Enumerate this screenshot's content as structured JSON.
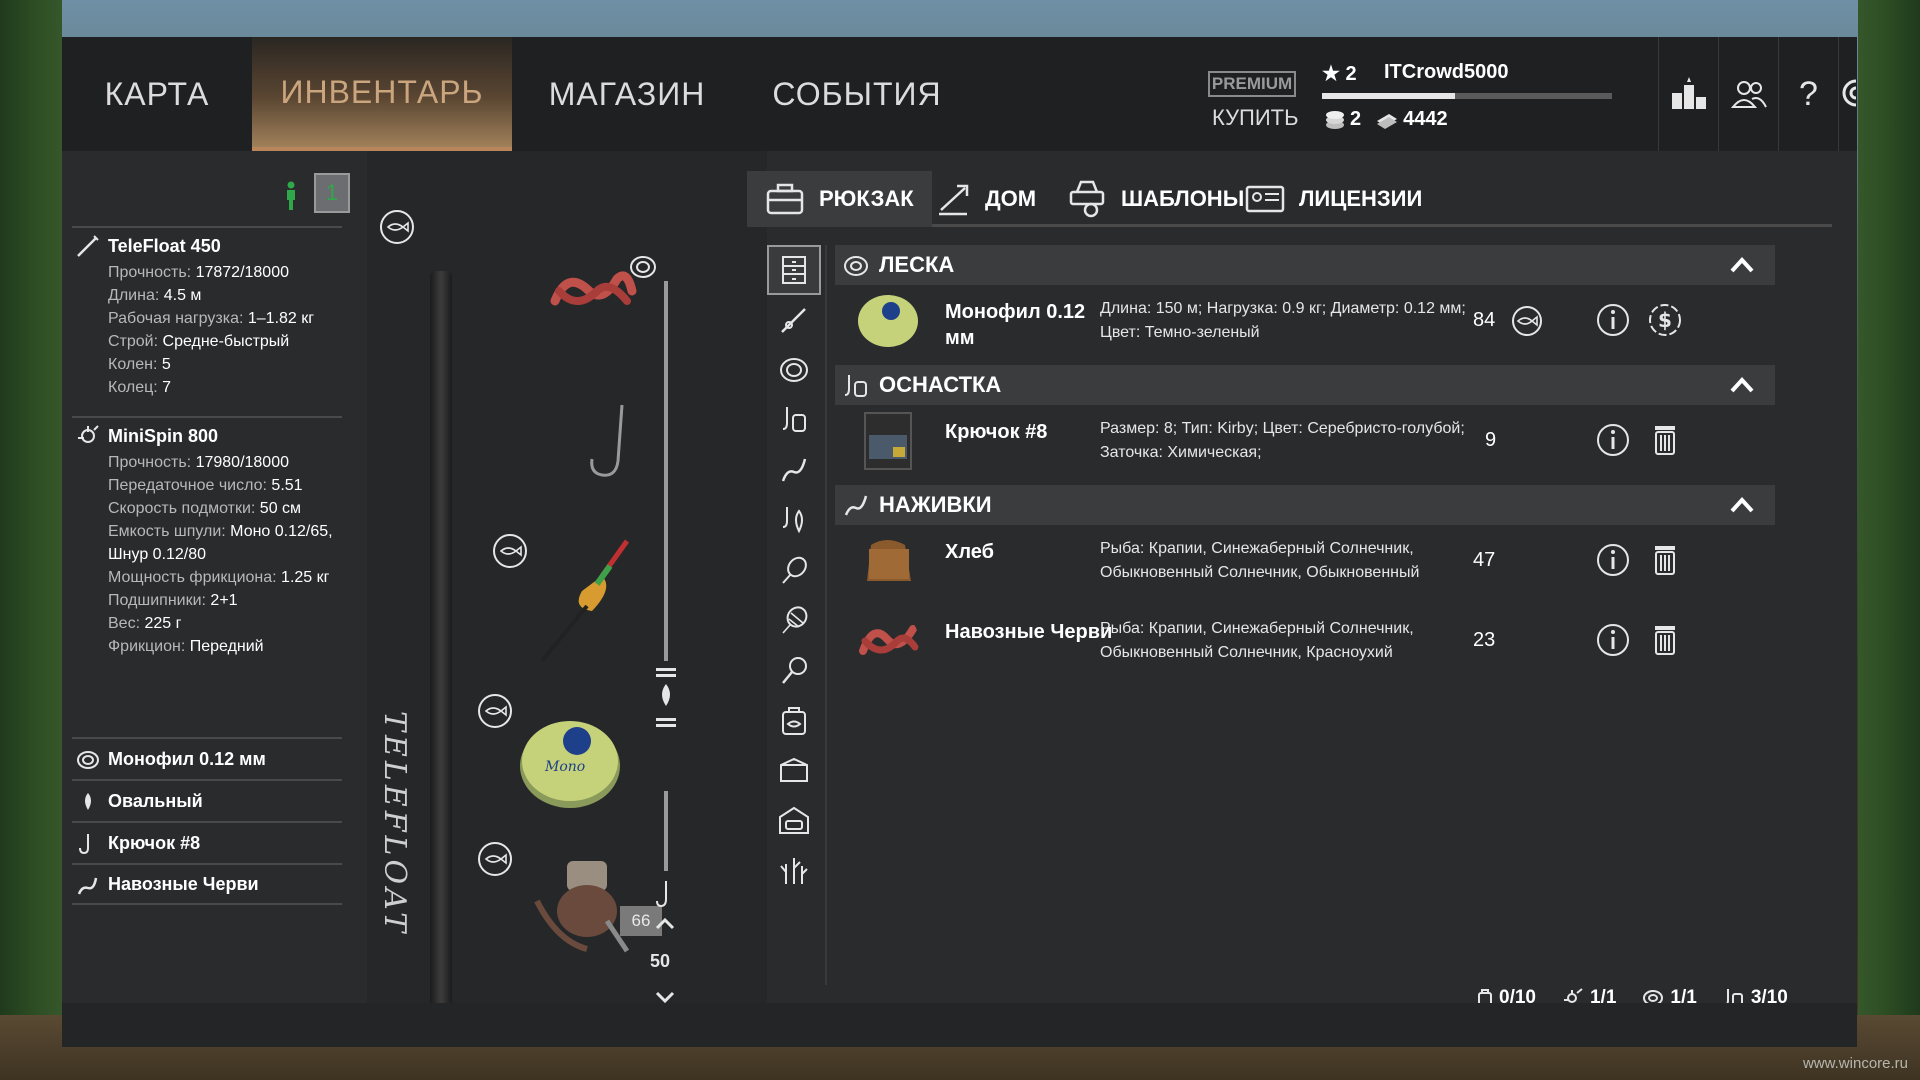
{
  "nav": {
    "tabs": [
      "КАРТА",
      "ИНВЕНТАРЬ",
      "МАГАЗИН",
      "СОБЫТИЯ"
    ],
    "active_index": 1,
    "premium_label": "PREMIUM",
    "buy_label": "КУПИТЬ"
  },
  "user": {
    "level": "2",
    "name": "ITCrowd5000",
    "xp_fraction": 0.46,
    "silver": "2",
    "gold": "4442"
  },
  "top_icons": [
    "leaderboard-icon",
    "friends-icon",
    "help-icon",
    "settings-icon"
  ],
  "help_glyph": "?",
  "rod_slot": "1",
  "rod_stats": {
    "title": "TeleFloat 450",
    "lines": [
      {
        "k": "Прочность:",
        "v": " 17872/18000"
      },
      {
        "k": "Длина:",
        "v": " 4.5 м"
      },
      {
        "k": "Рабочая нагрузка:",
        "v": " 1–1.82 кг"
      },
      {
        "k": "Строй:",
        "v": " Средне-быстрый"
      },
      {
        "k": "Колен:",
        "v": " 5"
      },
      {
        "k": "Колец:",
        "v": " 7"
      }
    ]
  },
  "reel_stats": {
    "title": "MiniSpin 800",
    "lines": [
      {
        "k": "Прочность:",
        "v": " 17980/18000"
      },
      {
        "k": "Передаточное число:",
        "v": " 5.51"
      },
      {
        "k": "Скорость подмотки:",
        "v": " 50 см"
      },
      {
        "k": "Емкость шпули:",
        "v": " Моно 0.12/65, Шнур 0.12/80"
      },
      {
        "k": "Мощность фрикциона:",
        "v": " 1.25 кг"
      },
      {
        "k": "Подшипники:",
        "v": " 2+1"
      },
      {
        "k": "Вес:",
        "v": " 225 г"
      },
      {
        "k": "Фрикцион:",
        "v": " Передний"
      }
    ]
  },
  "tackle_items": [
    "Монофил 0.12 мм",
    "Овальный",
    "Крючок #8",
    "Навозные Черви"
  ],
  "equip": {
    "rod_label": "TELEFLOAT",
    "line_counter": "66",
    "leader_value": "50"
  },
  "subtabs": [
    "РЮКЗАК",
    "ДОМ",
    "ШАБЛОНЫ",
    "ЛИЦЕНЗИИ"
  ],
  "sections": [
    {
      "title": "ЛЕСКА",
      "rows": [
        {
          "name": "Монофил 0.12 мм",
          "desc": "Длина: 150 м; Нагрузка: 0.9 кг; Диаметр: 0.12 мм; Цвет: Темно-зеленый",
          "qty": "84",
          "action2": "sell-icon"
        }
      ]
    },
    {
      "title": "ОСНАСТКА",
      "rows": [
        {
          "name": "Крючок #8",
          "desc": "Размер: 8; Тип: Kirby; Цвет: Серебристо-голубой; Заточка: Химическая;",
          "qty": "9",
          "action2": "trash-icon"
        }
      ]
    },
    {
      "title": "НАЖИВКИ",
      "rows": [
        {
          "name": "Хлеб",
          "desc": "Рыба: Крапии, Синежаберный  Солнечник, Обыкновенный Солнечник, Обыкновенный",
          "qty": "47",
          "action2": "trash-icon"
        },
        {
          "name": "Навозные Черви",
          "desc": "Рыба: Крапии, Синежаберный Солнечник, Обыкновенный Солнечник, Красноухий",
          "qty": "23",
          "action2": "trash-icon"
        }
      ]
    }
  ],
  "footer": [
    {
      "icon": "bag-icon",
      "value": "0/10"
    },
    {
      "icon": "rod-icon",
      "value": "1/1"
    },
    {
      "icon": "line-spool-icon",
      "value": "1/1"
    },
    {
      "icon": "tackle-icon",
      "value": "3/10"
    }
  ],
  "watermark": "www.wincore.ru",
  "colors": {
    "accent": "#b8865a",
    "active_tab_text": "#caa57e",
    "green": "#2fa84a"
  }
}
